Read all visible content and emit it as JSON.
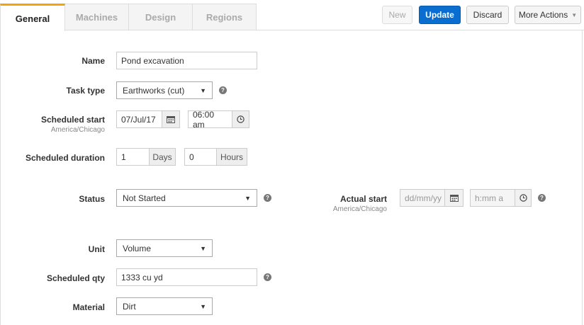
{
  "tabs": [
    {
      "label": "General",
      "active": true
    },
    {
      "label": "Machines",
      "active": false
    },
    {
      "label": "Design",
      "active": false
    },
    {
      "label": "Regions",
      "active": false
    }
  ],
  "toolbar": {
    "new_label": "New",
    "update_label": "Update",
    "discard_label": "Discard",
    "more_actions_label": "More Actions"
  },
  "form": {
    "name": {
      "label": "Name",
      "value": "Pond excavation"
    },
    "task_type": {
      "label": "Task type",
      "value": "Earthworks (cut)"
    },
    "scheduled_start": {
      "label": "Scheduled start",
      "timezone": "America/Chicago",
      "date": "07/Jul/17",
      "time": "06:00 am"
    },
    "scheduled_duration": {
      "label": "Scheduled duration",
      "days_value": "1",
      "days_unit": "Days",
      "hours_value": "0",
      "hours_unit": "Hours"
    },
    "status": {
      "label": "Status",
      "value": "Not Started"
    },
    "actual_start": {
      "label": "Actual start",
      "timezone": "America/Chicago",
      "date_placeholder": "dd/mm/yy",
      "time_placeholder": "h:mm a"
    },
    "unit": {
      "label": "Unit",
      "value": "Volume"
    },
    "scheduled_qty": {
      "label": "Scheduled qty",
      "value": "1333 cu yd"
    },
    "material": {
      "label": "Material",
      "value": "Dirt"
    }
  },
  "colors": {
    "primary": "#0a6ed1",
    "active_tab_accent": "#f0a30a"
  }
}
